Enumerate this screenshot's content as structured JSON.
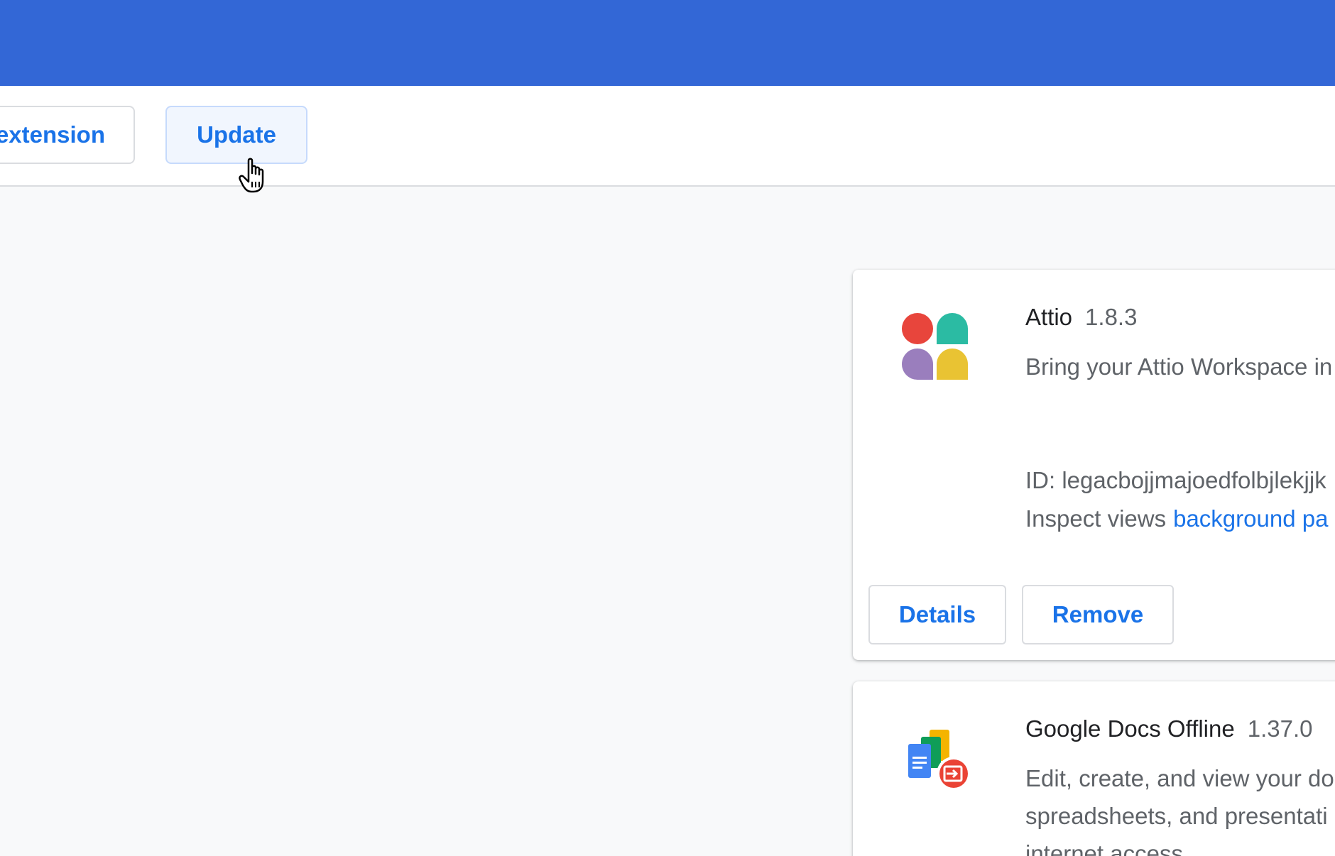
{
  "toolbar": {
    "pack_label": "extension",
    "update_label": "Update"
  },
  "extensions": [
    {
      "name": "Attio",
      "version": "1.8.3",
      "description": "Bring your Attio Workspace in",
      "id": "ID: legacbojjmajoedfolbjlekjjk",
      "inspect_label": "Inspect views",
      "inspect_link": "background pa",
      "details_label": "Details",
      "remove_label": "Remove",
      "icon": "attio-logo-icon"
    },
    {
      "name": "Google Docs Offline",
      "version": "1.37.0",
      "description_lines": [
        "Edit, create, and view your do",
        "spreadsheets, and presentati",
        "internet access."
      ],
      "icon": "google-docs-offline-icon"
    }
  ],
  "colors": {
    "header": "#3367d6",
    "accent": "#1a73e8",
    "background": "#f8f9fa"
  }
}
